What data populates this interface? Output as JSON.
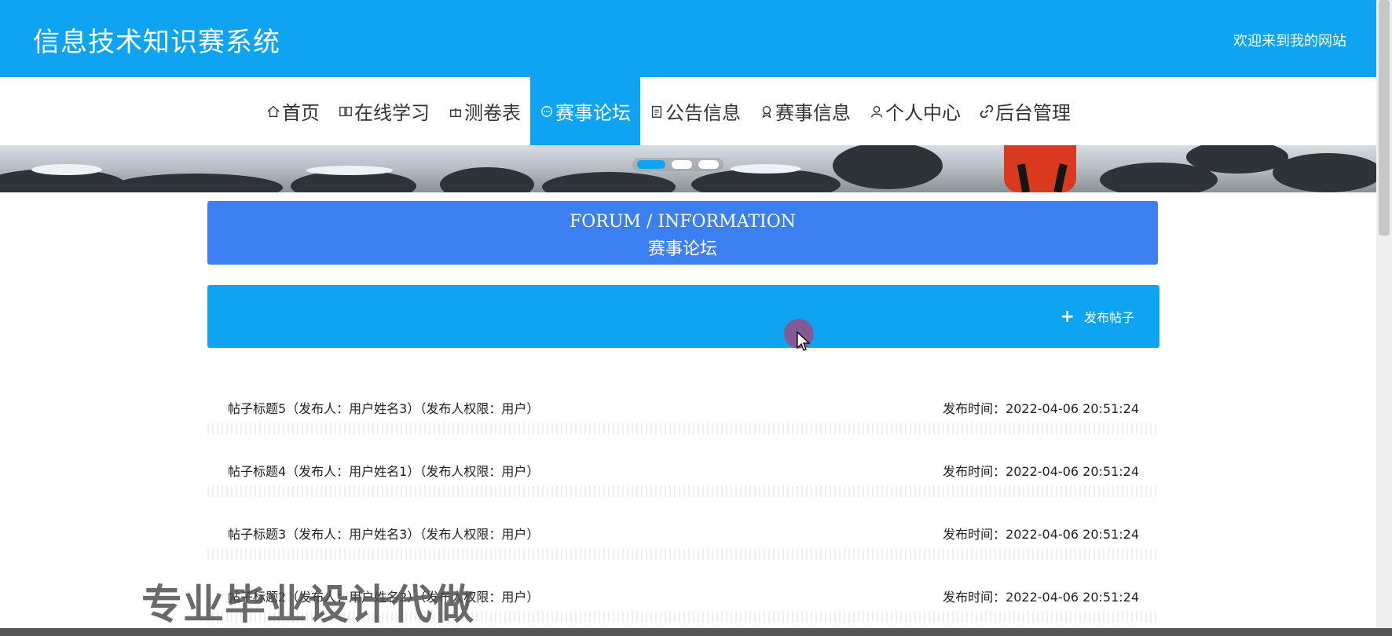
{
  "header": {
    "site_title": "信息技术知识赛系统",
    "welcome": "欢迎来到我的网站"
  },
  "nav": {
    "items": [
      {
        "label": "首页",
        "icon": "home-icon"
      },
      {
        "label": "在线学习",
        "icon": "book-icon"
      },
      {
        "label": "测卷表",
        "icon": "gift-icon"
      },
      {
        "label": "赛事论坛",
        "icon": "chat-icon",
        "active": true
      },
      {
        "label": "公告信息",
        "icon": "clipboard-icon"
      },
      {
        "label": "赛事信息",
        "icon": "ribbon-icon"
      },
      {
        "label": "个人中心",
        "icon": "user-icon"
      },
      {
        "label": "后台管理",
        "icon": "link-icon"
      }
    ]
  },
  "forum": {
    "title_en": "FORUM / INFORMATION",
    "title_cn": "赛事论坛",
    "publish_label": "发布帖子"
  },
  "posts": [
    {
      "title": "帖子标题5（发布人：用户姓名3）（发布人权限：用户）",
      "time": "发布时间：2022-04-06 20:51:24"
    },
    {
      "title": "帖子标题4（发布人：用户姓名1）（发布人权限：用户）",
      "time": "发布时间：2022-04-06 20:51:24"
    },
    {
      "title": "帖子标题3（发布人：用户姓名3）（发布人权限：用户）",
      "time": "发布时间：2022-04-06 20:51:24"
    },
    {
      "title": "帖子标题2（发布人：用户姓名2）（发布人权限：用户）",
      "time": "发布时间：2022-04-06 20:51:24"
    }
  ],
  "watermark": "专业毕业设计代做",
  "colors": {
    "primary": "#0ea4f2",
    "header_blue": "#3b7ff0"
  }
}
